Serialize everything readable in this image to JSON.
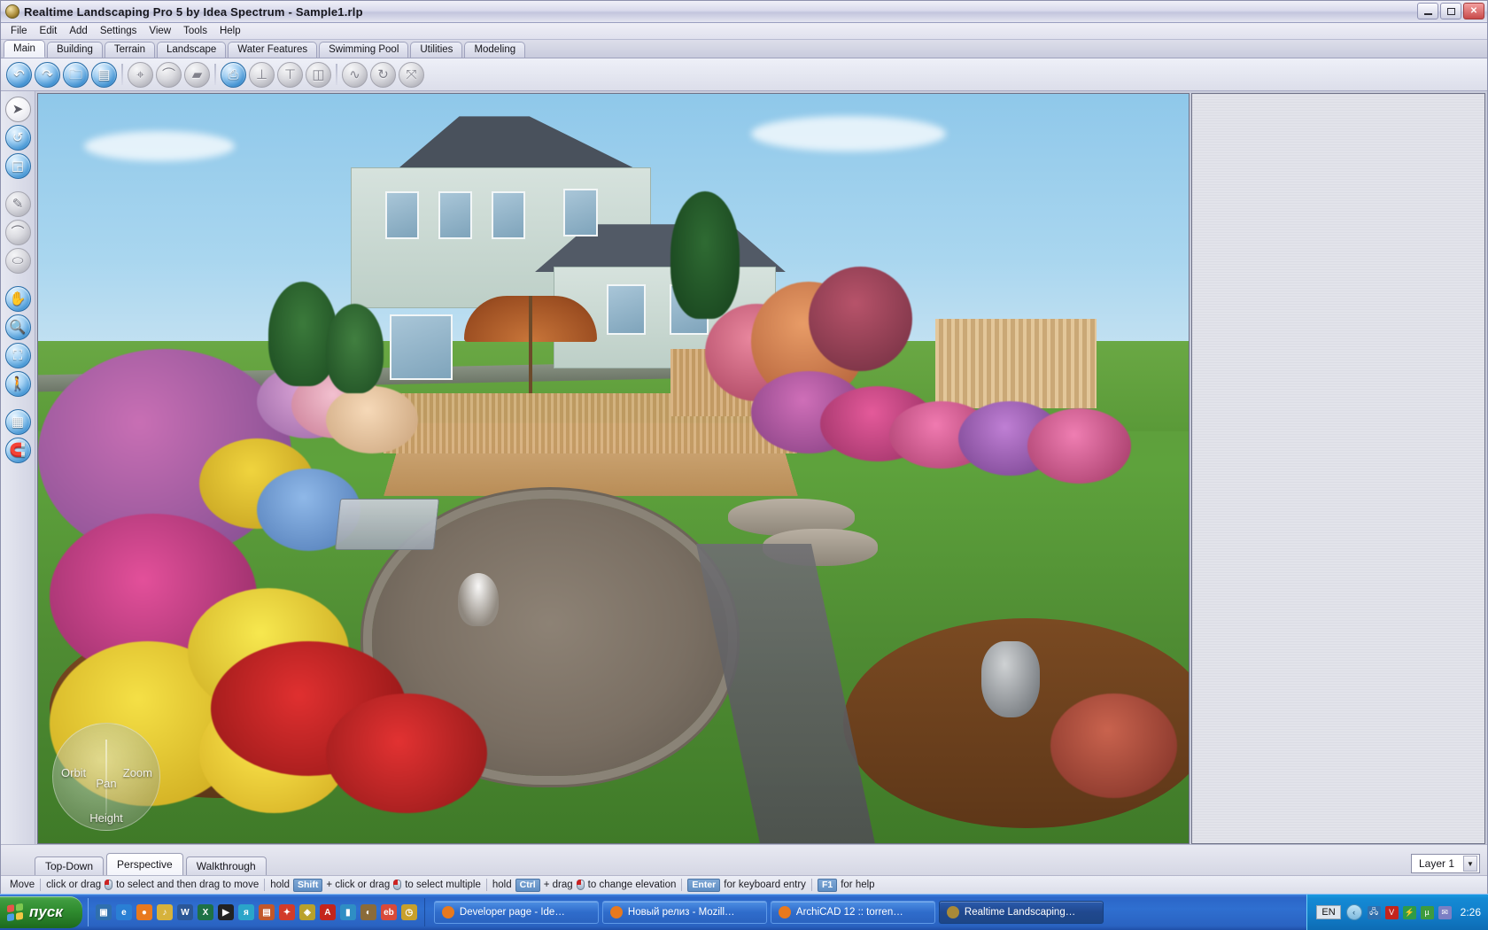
{
  "window": {
    "title": "Realtime Landscaping Pro 5 by Idea Spectrum - Sample1.rlp",
    "icon": "app-globe-icon",
    "buttons": {
      "minimize": "_",
      "restore": "❐",
      "close": "✕"
    }
  },
  "menu": {
    "items": [
      {
        "label": "File"
      },
      {
        "label": "Edit"
      },
      {
        "label": "Add"
      },
      {
        "label": "Settings"
      },
      {
        "label": "View"
      },
      {
        "label": "Tools"
      },
      {
        "label": "Help"
      }
    ]
  },
  "ribbon": {
    "active": "Main",
    "tabs": [
      {
        "label": "Main"
      },
      {
        "label": "Building"
      },
      {
        "label": "Terrain"
      },
      {
        "label": "Landscape"
      },
      {
        "label": "Water Features"
      },
      {
        "label": "Swimming Pool"
      },
      {
        "label": "Utilities"
      },
      {
        "label": "Modeling"
      }
    ]
  },
  "toolbar": {
    "buttons": [
      {
        "name": "undo-icon",
        "glyph": "↶",
        "enabled": true
      },
      {
        "name": "redo-icon",
        "glyph": "↷",
        "enabled": true
      },
      {
        "name": "open-folder-icon",
        "glyph": "🗀",
        "enabled": true
      },
      {
        "name": "save-icon",
        "glyph": "▤",
        "enabled": true
      },
      {
        "name": "pick-tool-icon",
        "glyph": "⌖",
        "enabled": false
      },
      {
        "name": "curve-tool-icon",
        "glyph": "⌒",
        "enabled": false
      },
      {
        "name": "wall-tool-icon",
        "glyph": "▰",
        "enabled": false
      },
      {
        "name": "print-icon",
        "glyph": "⎙",
        "enabled": true
      },
      {
        "name": "terrain-point-icon",
        "glyph": "⊥",
        "enabled": false
      },
      {
        "name": "flatten-icon",
        "glyph": "⊤",
        "enabled": false
      },
      {
        "name": "mirror-icon",
        "glyph": "◫",
        "enabled": false
      },
      {
        "name": "smooth-icon",
        "glyph": "∿",
        "enabled": false
      },
      {
        "name": "rotate-icon",
        "glyph": "↻",
        "enabled": false
      },
      {
        "name": "scale-icon",
        "glyph": "⤧",
        "enabled": false
      }
    ]
  },
  "left_rail": {
    "buttons": [
      {
        "name": "select-arrow-icon",
        "glyph": "➤",
        "state": "sel"
      },
      {
        "name": "rotate-object-icon",
        "glyph": "↺",
        "state": "on"
      },
      {
        "name": "resize-object-icon",
        "glyph": "◲",
        "state": "on"
      },
      {
        "name": "draw-spline-icon",
        "glyph": "✎",
        "state": "off"
      },
      {
        "name": "draw-line-icon",
        "glyph": "⌒",
        "state": "off"
      },
      {
        "name": "draw-region-icon",
        "glyph": "⬭",
        "state": "off"
      },
      {
        "name": "pan-hand-icon",
        "glyph": "✋",
        "state": "on"
      },
      {
        "name": "zoom-magnifier-icon",
        "glyph": "🔍",
        "state": "on"
      },
      {
        "name": "zoom-extents-icon",
        "glyph": "⛶",
        "state": "on"
      },
      {
        "name": "walk-icon",
        "glyph": "🚶",
        "state": "on"
      },
      {
        "name": "grid-terrain-icon",
        "glyph": "▦",
        "state": "on"
      },
      {
        "name": "magnet-snap-icon",
        "glyph": "🧲",
        "state": "on"
      }
    ]
  },
  "viewport": {
    "compass": {
      "orbit": "Orbit",
      "zoom": "Zoom",
      "pan": "Pan",
      "height": "Height"
    }
  },
  "view_tabs": {
    "active": "Perspective",
    "tabs": [
      {
        "label": "Top-Down"
      },
      {
        "label": "Perspective"
      },
      {
        "label": "Walkthrough"
      }
    ]
  },
  "layer": {
    "selected": "Layer 1",
    "arrow": "▼"
  },
  "status_bar": {
    "mode": "Move",
    "hints": [
      {
        "pre": "click or drag",
        "mouse": true,
        "key": "",
        "mid": "",
        "post": "to select and then drag to move"
      },
      {
        "pre": "hold",
        "mouse": false,
        "key": "Shift",
        "mid": "+ click or drag",
        "post": "to select multiple",
        "mouse_after": true
      },
      {
        "pre": "hold",
        "mouse": false,
        "key": "Ctrl",
        "mid": "+ drag",
        "post": "to change elevation",
        "mouse_after": true
      },
      {
        "pre": "",
        "mouse": false,
        "key": "Enter",
        "mid": "",
        "post": "for keyboard entry"
      },
      {
        "pre": "",
        "mouse": false,
        "key": "F1",
        "mid": "",
        "post": "for help"
      }
    ]
  },
  "taskbar": {
    "start_label": "пуск",
    "start_colors": [
      "#e8534a",
      "#7ec850",
      "#4a9ee8",
      "#f2c744"
    ],
    "quick_launch": [
      {
        "name": "show-desktop-icon",
        "glyph": "▣",
        "color": "#2f6fae"
      },
      {
        "name": "internet-explorer-icon",
        "glyph": "e",
        "color": "#2a7fd4"
      },
      {
        "name": "firefox-icon",
        "glyph": "●",
        "color": "#e8791e"
      },
      {
        "name": "winamp-icon",
        "glyph": "♪",
        "color": "#d6b23c"
      },
      {
        "name": "word-icon",
        "glyph": "W",
        "color": "#2b5797"
      },
      {
        "name": "excel-icon",
        "glyph": "X",
        "color": "#1e7145"
      },
      {
        "name": "media-player-icon",
        "glyph": "▶",
        "color": "#222"
      },
      {
        "name": "punto-switcher-icon",
        "glyph": "я",
        "color": "#2aa5c9"
      },
      {
        "name": "total-commander-icon",
        "glyph": "▤",
        "color": "#c2572a"
      },
      {
        "name": "firework-icon",
        "glyph": "✦",
        "color": "#d23b2a"
      },
      {
        "name": "dreamweaver-icon",
        "glyph": "◈",
        "color": "#b9a12c"
      },
      {
        "name": "acrobat-icon",
        "glyph": "A",
        "color": "#c4241c"
      },
      {
        "name": "usb-drive-icon",
        "glyph": "▮",
        "color": "#2f8ec4"
      },
      {
        "name": "nero-icon",
        "glyph": "◐",
        "color": "#8a6b3a"
      },
      {
        "name": "ebay-icon",
        "glyph": "eb",
        "color": "#d94a3a"
      },
      {
        "name": "clock-widget-icon",
        "glyph": "◷",
        "color": "#c8a02c"
      }
    ],
    "tasks": [
      {
        "label": "Developer page - Ide…",
        "icon": "firefox-icon",
        "color": "#e8791e",
        "active": false
      },
      {
        "label": "Новый релиз - Mozill…",
        "icon": "firefox-icon",
        "color": "#e8791e",
        "active": false
      },
      {
        "label": "ArchiCAD 12 :: torren…",
        "icon": "firefox-icon",
        "color": "#e8791e",
        "active": false
      },
      {
        "label": "Realtime Landscaping…",
        "icon": "app-globe-icon",
        "color": "#a98a38",
        "active": true
      }
    ],
    "tray": {
      "language": "EN",
      "chevron": "‹",
      "icons": [
        {
          "name": "network-icon",
          "glyph": "🖧",
          "color": "#2f6fae"
        },
        {
          "name": "antivirus-icon",
          "glyph": "V",
          "color": "#c4241c"
        },
        {
          "name": "power-icon",
          "glyph": "⚡",
          "color": "#2e9b48"
        },
        {
          "name": "utorrent-icon",
          "glyph": "µ",
          "color": "#3e9b3e"
        },
        {
          "name": "mail-icon",
          "glyph": "✉",
          "color": "#7b7fc4"
        }
      ],
      "clock": "2:26"
    }
  }
}
